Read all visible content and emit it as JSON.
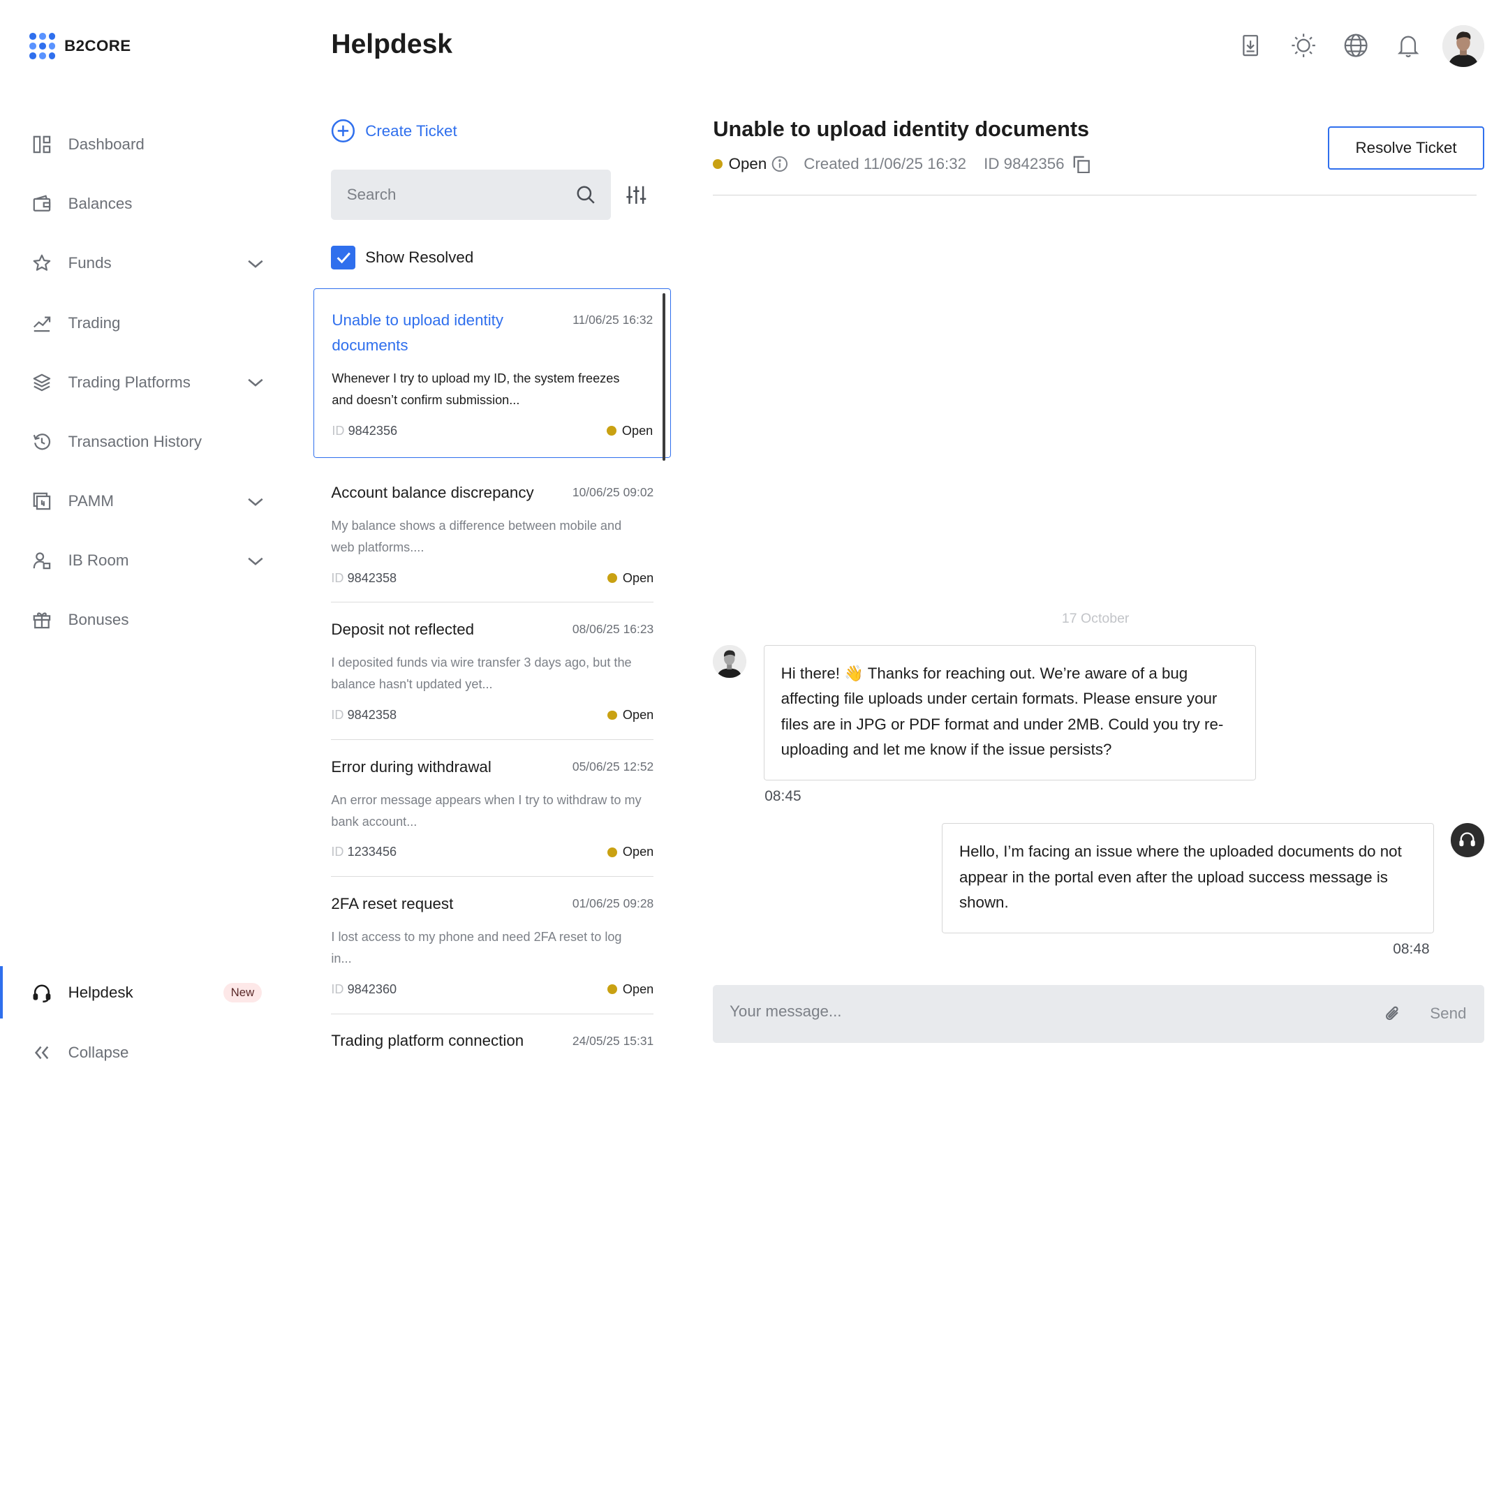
{
  "brand": {
    "name": "B2CORE"
  },
  "header": {
    "title": "Helpdesk"
  },
  "sidebar": {
    "items": [
      {
        "label": "Dashboard",
        "icon": "dashboard-icon",
        "expandable": false
      },
      {
        "label": "Balances",
        "icon": "wallet-icon",
        "expandable": false
      },
      {
        "label": "Funds",
        "icon": "star-icon",
        "expandable": true
      },
      {
        "label": "Trading",
        "icon": "chart-line-icon",
        "expandable": false
      },
      {
        "label": "Trading Platforms",
        "icon": "layers-icon",
        "expandable": true
      },
      {
        "label": "Transaction History",
        "icon": "history-icon",
        "expandable": false
      },
      {
        "label": "PAMM",
        "icon": "pamm-icon",
        "expandable": true
      },
      {
        "label": "IB Room",
        "icon": "users-icon",
        "expandable": true
      },
      {
        "label": "Bonuses",
        "icon": "gift-icon",
        "expandable": false
      }
    ],
    "helpdesk": {
      "label": "Helpdesk",
      "badge": "New"
    },
    "collapse": {
      "label": "Collapse"
    }
  },
  "tickets_panel": {
    "create_label": "Create Ticket",
    "search_placeholder": "Search",
    "show_resolved_label": "Show Resolved",
    "show_resolved_checked": true,
    "id_prefix": "ID",
    "tickets": [
      {
        "title": "Unable to upload identity documents",
        "date": "11/06/25 16:32",
        "desc": "Whenever I try to upload my ID, the system freezes and doesn’t confirm submission...",
        "id": "9842356",
        "status": "Open",
        "selected": true
      },
      {
        "title": "Account balance discrepancy",
        "date": "10/06/25 09:02",
        "desc": "My balance shows a difference between mobile and web platforms....",
        "id": "9842358",
        "status": "Open"
      },
      {
        "title": "Deposit not reflected",
        "date": "08/06/25 16:23",
        "desc": "I deposited funds via wire transfer 3 days ago, but the balance hasn't updated yet...",
        "id": "9842358",
        "status": "Open"
      },
      {
        "title": "Error during withdrawal",
        "date": "05/06/25 12:52",
        "desc": "An error message appears when I try to withdraw to my bank account...",
        "id": "1233456",
        "status": "Open"
      },
      {
        "title": "2FA reset request",
        "date": "01/06/25 09:28",
        "desc": "I lost access to my phone and need 2FA reset to log in...",
        "id": "9842360",
        "status": "Open"
      },
      {
        "title": "Trading platform connection",
        "date": "24/05/25 15:31",
        "desc": "",
        "id": "",
        "status": ""
      }
    ]
  },
  "detail": {
    "title": "Unable to upload identity documents",
    "status": "Open",
    "created": "Created 11/06/25 16:32",
    "id": "ID 9842356",
    "resolve_label": "Resolve Ticket",
    "day_label": "17 October",
    "messages": [
      {
        "from": "agent",
        "text": "Hi there! 👋 Thanks for reaching out. We’re aware of a bug affecting file uploads under certain formats. Please ensure your files are in JPG or PDF format and under 2MB. Could you try re-uploading and let me know if the issue persists?",
        "time": "08:45"
      },
      {
        "from": "user",
        "text": "Hello, I’m facing an issue where the uploaded documents do not appear in the portal even after the upload success message is shown.",
        "time": "08:48"
      }
    ],
    "composer": {
      "placeholder": "Your message...",
      "send_label": "Send"
    }
  },
  "colors": {
    "accent": "#2f6fed",
    "status_open": "#c9a112",
    "badge_bg": "#fde8e8"
  }
}
